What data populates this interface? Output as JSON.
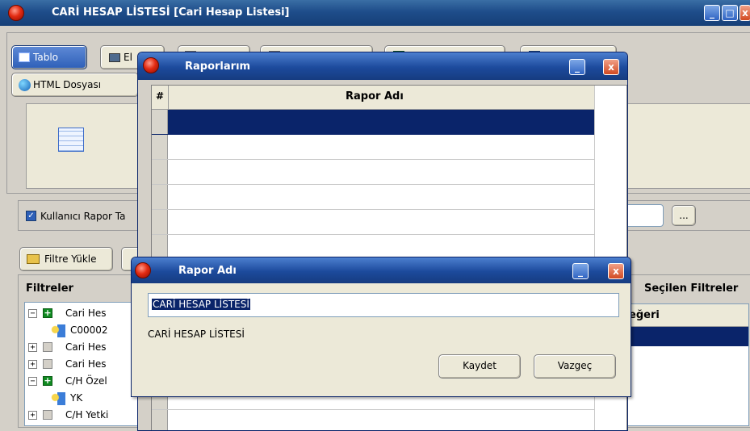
{
  "main_window": {
    "title": "CARİ HESAP LİSTESİ [Cari Hesap Listesi]",
    "format_buttons": [
      {
        "label": "Tablo",
        "icon": "table-icon"
      },
      {
        "label": "El",
        "icon": "monitor-icon"
      },
      {
        "label": "",
        "icon": "document-icon"
      },
      {
        "label": "",
        "icon": "ascii-icon"
      },
      {
        "label": "",
        "icon": "excel-icon"
      },
      {
        "label": "",
        "icon": "word-icon"
      }
    ],
    "html_button_label": "HTML Dosyası",
    "user_report_checkbox_label": "Kullanıcı Rapor Ta",
    "browse_button_label": "...",
    "filter_load_label": "Filtre Yükle",
    "filters_heading": "Filtreler",
    "selected_filters_heading": "Seçilen Filtreler",
    "value_column_header": "eğeri",
    "tree": [
      {
        "indent": 0,
        "expander": "−",
        "check": "green",
        "label": "Cari Hes"
      },
      {
        "indent": 1,
        "key": true,
        "label": "C00002"
      },
      {
        "indent": 0,
        "expander": "+",
        "check": "gray",
        "label": "Cari Hes"
      },
      {
        "indent": 0,
        "expander": "+",
        "check": "gray",
        "label": "Cari Hes"
      },
      {
        "indent": 0,
        "expander": "−",
        "check": "green",
        "label": "C/H Özel"
      },
      {
        "indent": 1,
        "key": true,
        "label": "YK"
      },
      {
        "indent": 0,
        "expander": "+",
        "check": "gray",
        "label": "C/H Yetki"
      }
    ]
  },
  "reports_dialog": {
    "title": "Raporlarım",
    "col_hash": "#",
    "col_report_name": "Rapor Adı"
  },
  "name_dialog": {
    "title": "Rapor Adı",
    "input_value": "CARİ HESAP LİSTESİ",
    "preview_text": "CARİ HESAP LİSTESİ",
    "save_label": "Kaydet",
    "cancel_label": "Vazgeç"
  }
}
